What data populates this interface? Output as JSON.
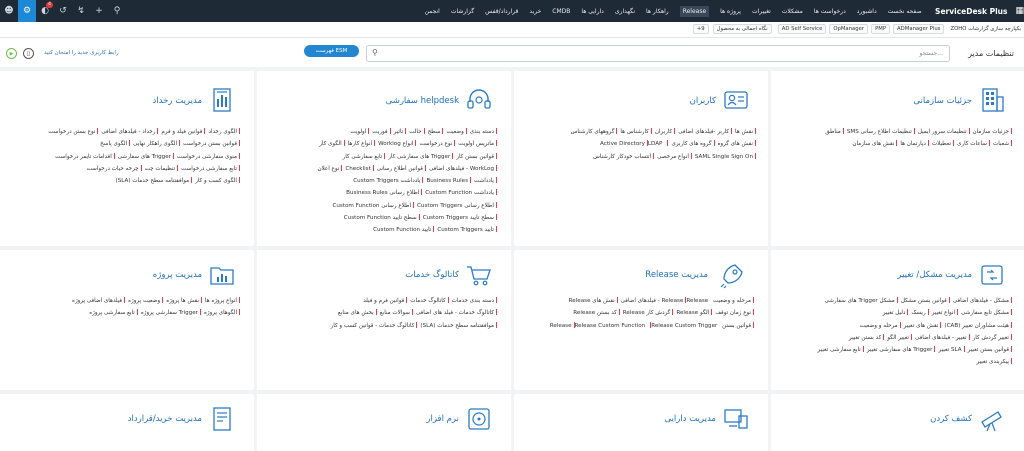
{
  "topbar": {
    "brand": "ServiceDesk Plus",
    "nav": [
      "صفحه نخست",
      "داشبورد",
      "درخواست ها",
      "مشکلات",
      "تغییرات",
      "پروژه ها",
      "Release",
      "راهکار ها",
      "نگهداری",
      "دارایی ها",
      "CMDB",
      "خرید",
      "قرارداد/قفس",
      "گزارشات",
      "انجمن"
    ],
    "highlighted": "Release",
    "badge_count": "4",
    "colors": {
      "bg": "#1f2a37",
      "active": "#1d88d6"
    }
  },
  "quickbar": {
    "items": [
      "یکپارچه سازی گزارشات ZOHO",
      "ADManager Plus",
      "PMP",
      "OpManager",
      "AD Self Service",
      "نگاه اجمالی به محصول"
    ],
    "badge": "9+"
  },
  "header": {
    "title": "تنظیمات مدیر",
    "search_placeholder": "جستجو...",
    "esm_label": "فهرست ESM",
    "new_ui_text": "رابط کاربری جدید را امتحان کنید"
  },
  "cards": [
    {
      "title": "جزئیات سازمانی",
      "icon": "building-icon",
      "rows": [
        [
          "جزئیات سازمان",
          "تنظیمات سرور ایمیل",
          "تنظیمات اطلاع رسانی SMS",
          "مناطق"
        ],
        [
          "شعبات",
          "ساعات کاری",
          "تعطیلات",
          "دپارتمان ها",
          "نقش های سازمان"
        ]
      ]
    },
    {
      "title": "کاربران",
      "icon": "user-card-icon",
      "rows": [
        [
          "نقش ها",
          "کاربر -فیلدهای اضافی",
          "کاربران",
          "کارشناس ها",
          "گروههای کارشناس"
        ],
        [
          "نقش های گروه",
          "گروه های کاربری",
          "Active Directory",
          "LDAP"
        ],
        [
          "SAML Single Sign On",
          "انواع مرخصی",
          "انتساب خودکار کارشناس"
        ]
      ]
    },
    {
      "title": "helpdesk سفارشی",
      "icon": "headset-icon",
      "rows": [
        [
          "دسته بندی",
          "وضعیت",
          "سطح",
          "حالت",
          "تاثیر",
          "فوریت",
          "اولویت"
        ],
        [
          "ماتریس اولویت",
          "نوع درخواست",
          "انواع Worklog",
          "انواع کارها",
          "الگوی کار"
        ],
        [
          "قوانین بستن کار",
          "Trigger های سفارشی کار",
          "تابع سفارشی کار"
        ],
        [
          "WorkLog - فیلدهای اضافی",
          "قوانین اطلاع رسانی",
          "Checklist",
          "نوع اعلان"
        ],
        [
          "یادداشت",
          "Business Rules",
          "یادداشت Custom Triggers"
        ],
        [
          "یادداشت Custom Function",
          "اطلاع رسانی Business Rules"
        ],
        [
          "اطلاع رسانی Custom Triggers",
          "اطلاع رسانی Custom Function"
        ],
        [
          "سطح تایید Custom Triggers",
          "سطح تایید Custom Function"
        ],
        [
          "تایید Custom Triggers",
          "تایید Custom Function"
        ]
      ]
    },
    {
      "title": "مدیریت رخداد",
      "icon": "document-chart-icon",
      "rows": [
        [
          "الگوی رخداد",
          "قوانین فیلد و فرم",
          "رخداد - فیلدهای اضافی",
          "نوع بستن درخواست"
        ],
        [
          "قوانین بستن درخواست",
          "الگوی راهکار نهایی",
          "الگوی پاسخ"
        ],
        [
          "منوی سفارشی درخواست",
          "Trigger های سفارشی",
          "اقدامات تایمر درخواست"
        ],
        [
          "تابع سفارشی درخواست",
          "تنظیمات چت",
          "چرخه حیات درخواست"
        ],
        [
          "الگوی کسب و کار",
          "موافقتنامه سطح خدمات (SLA)"
        ]
      ]
    },
    {
      "title": "مدیریت مشکل/ تغییر",
      "icon": "problem-change-icon",
      "rows": [
        [
          "مشکل - فیلدهای اضافی",
          "قوانین بستن مشکل",
          "مشکل Trigger های سفارشی"
        ],
        [
          "مشکل تابع سفارشی",
          "انواع تغییر",
          "ریسک",
          "دلیل تغییر"
        ],
        [
          "هیئت مشاوران تغییر (CAB)",
          "نقش های تغییر",
          "مرحله و وضعیت"
        ],
        [
          "تغییر گردش کار",
          "تغییر - فیلدهای اضافی",
          "تغییر الگو",
          "کد بستن تغییر"
        ],
        [
          "قوانین بستن تغییر",
          "SLA تغییر",
          "Trigger های سفارشی تغییر",
          "تابع سفارشی تغییر"
        ],
        [
          "پیکربندی تغییر"
        ]
      ]
    },
    {
      "title": "مدیریت Release",
      "icon": "rocket-icon",
      "rows": [
        [
          "مرحله و وضعیت Release",
          "Release - فیلدهای اضافی",
          "نقش های Release"
        ],
        [
          "نوع زمان توقف",
          "الگو Release",
          "گردش کار Release",
          "کد بستن Release"
        ],
        [
          "قوانین بستن Release",
          "Release Custom Function",
          "Release Custom Trigger"
        ]
      ]
    },
    {
      "title": "کاتالوگ خدمات",
      "icon": "cart-icon",
      "rows": [
        [
          "دسته بندی خدمات",
          "کاتالوگ خدمات",
          "قوانین فرم و فیلد"
        ],
        [
          "کاتالوگ خدمات - فیلد های اضافی",
          "سوالات منابع",
          "بخش های منابع"
        ],
        [
          "موافقتنامه سطح خدمات (SLA)",
          "کاتالوگ خدمات - قوانین کسب و کار"
        ]
      ]
    },
    {
      "title": "مدیریت پروژه",
      "icon": "folder-chart-icon",
      "rows": [
        [
          "انواع پروژه ها",
          "نقش ها پروژه",
          "وضعیت پروژه",
          "فیلدهای اضافی پروژه"
        ],
        [
          "الگوهای پروژه",
          "Trigger سفارشی پروژه",
          "تابع سفارشی پروژه"
        ]
      ]
    },
    {
      "title": "کشف کردن",
      "icon": "telescope-icon"
    },
    {
      "title": "مدیریت دارایی",
      "icon": "asset-icon"
    },
    {
      "title": "نرم افزار",
      "icon": "software-disc-icon"
    },
    {
      "title": "مدیریت خرید/قرارداد",
      "icon": "purchase-doc-icon"
    }
  ]
}
